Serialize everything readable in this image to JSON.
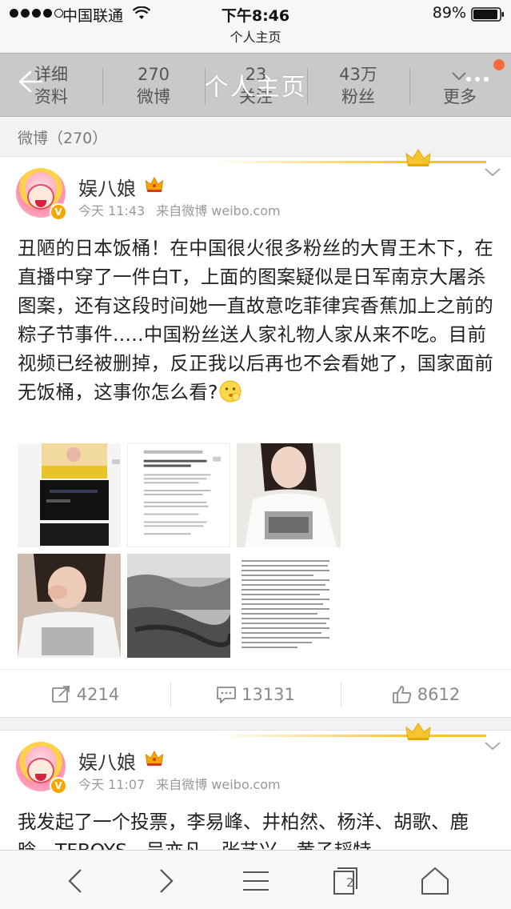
{
  "status_bar": {
    "carrier": "中国联通",
    "time": "下午8:46",
    "battery": "89%"
  },
  "page_url": "个人主页",
  "header": {
    "title": "个人主页",
    "stats": [
      {
        "num": "详细",
        "label": "资料"
      },
      {
        "num": "270",
        "label": "微博"
      },
      {
        "num": "23",
        "label": "关注"
      },
      {
        "num": "43万",
        "label": "粉丝"
      },
      {
        "num": "",
        "label": "更多"
      }
    ]
  },
  "section": {
    "title": "微博（270）"
  },
  "posts": [
    {
      "author": "娱八娘",
      "time": "今天 11:43",
      "source": "来自微博 weibo.com",
      "text": "丑陋的日本饭桶！在中国很火很多粉丝的大胃王木下，在直播中穿了一件白T，上面的图案疑似是日军南京大屠杀图案，还有这段时间她一直故意吃菲律宾香蕉加上之前的粽子节事件.....中国粉丝送人家礼物人家从来不吃。目前视频已经被删掉，反正我以后再也不会看她了，国家面前无饭桶，这事你怎么看?",
      "emoji": "thinking-emoji",
      "repost_count": "4214",
      "comment_count": "13131",
      "like_count": "8612"
    },
    {
      "author": "娱八娘",
      "time": "今天 11:07",
      "source": "来自微博 weibo.com",
      "text": "我发起了一个投票，李易峰、井柏然、杨洋、胡歌、鹿晗、TFBOYS、吴亦凡、张艺兴、黄子韬特"
    }
  ],
  "toolbar": {
    "tabs_count": "2"
  },
  "colors": {
    "accent_orange": "#f5a700",
    "crown_gold": "#f7c531",
    "notif_red": "#ff6a3d"
  }
}
